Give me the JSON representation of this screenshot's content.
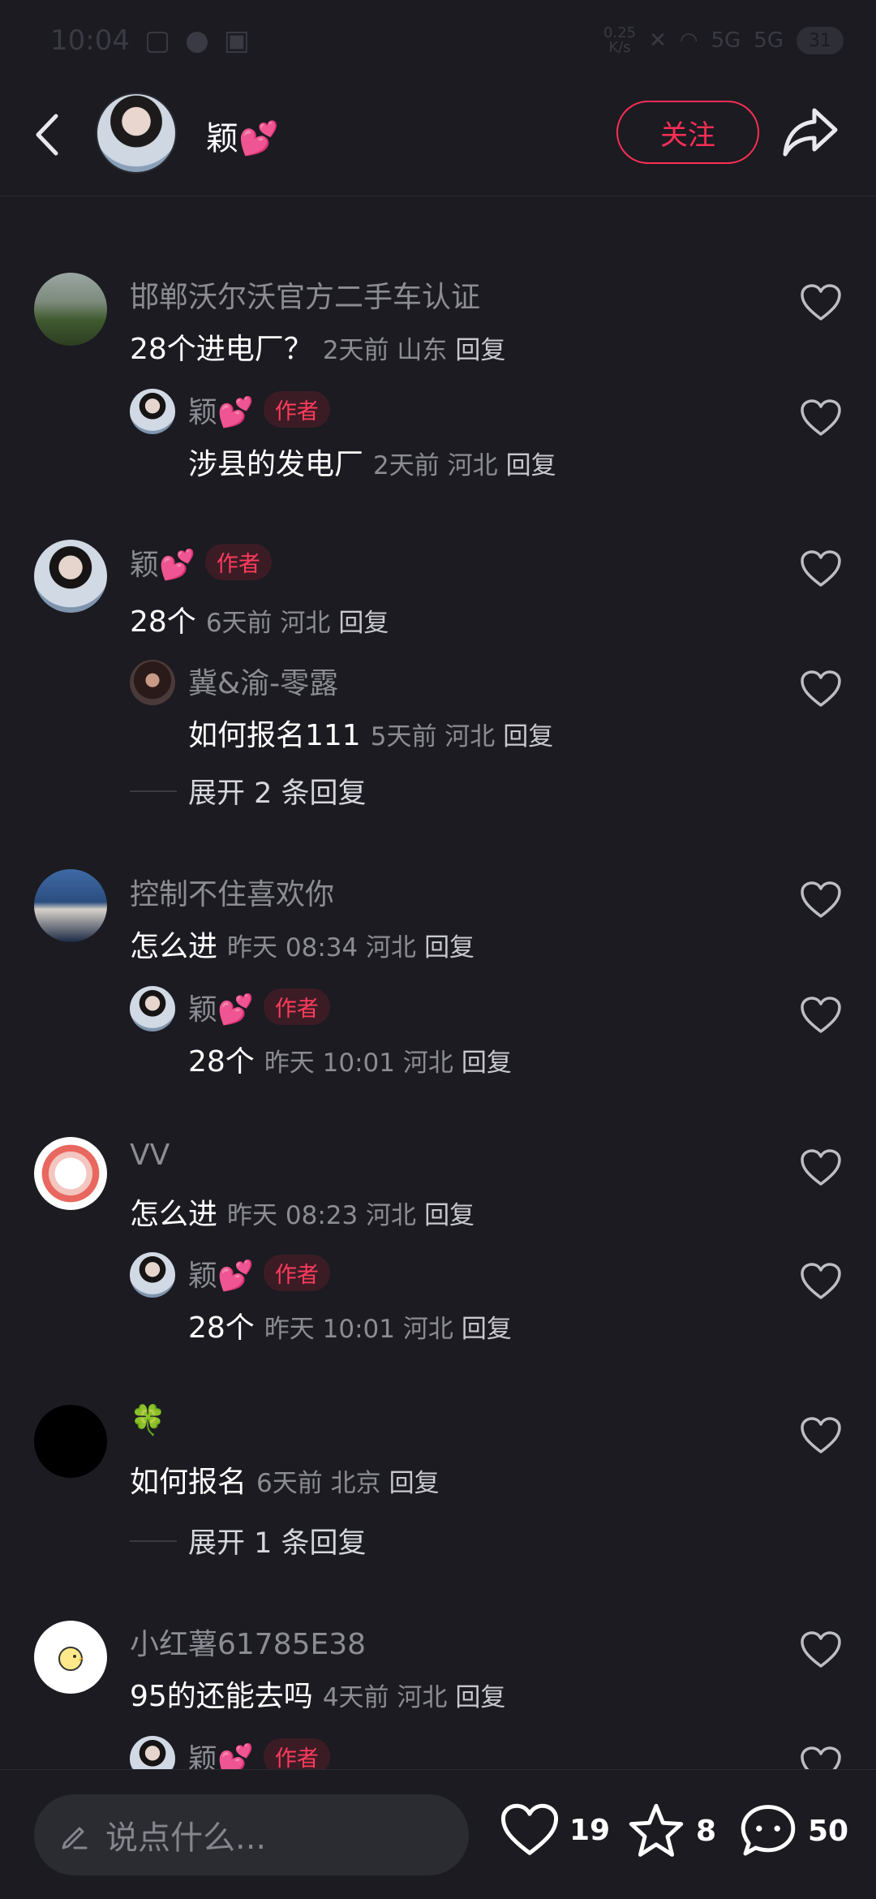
{
  "status_bar": {
    "time": "10:04",
    "net_speed_value": "0.25",
    "net_speed_unit": "K/s",
    "signal1": "5G",
    "signal2": "5G",
    "battery": "31"
  },
  "header": {
    "author_name": "颖💕",
    "follow_label": "关注"
  },
  "comments": [
    {
      "user": "邯郸沃尔沃官方二手车认证",
      "text": "28个进电厂？",
      "meta": "2天前 山东",
      "reply_label": "回复",
      "sub": {
        "user": "颖💕",
        "badge": "作者",
        "text": "涉县的发电厂",
        "meta": "2天前 河北",
        "reply_label": "回复"
      }
    },
    {
      "user": "颖💕",
      "badge": "作者",
      "text": "28个",
      "meta": "6天前 河北",
      "reply_label": "回复",
      "sub": {
        "user": "冀&渝-零露",
        "text": "如何报名111",
        "meta": "5天前 河北",
        "reply_label": "回复"
      },
      "expand": "展开 2 条回复"
    },
    {
      "user": "控制不住喜欢你",
      "text": "怎么进",
      "meta": "昨天 08:34 河北",
      "reply_label": "回复",
      "sub": {
        "user": "颖💕",
        "badge": "作者",
        "text": "28个",
        "meta": "昨天 10:01 河北",
        "reply_label": "回复"
      }
    },
    {
      "user": "VV",
      "text": "怎么进",
      "meta": "昨天 08:23 河北",
      "reply_label": "回复",
      "sub": {
        "user": "颖💕",
        "badge": "作者",
        "text": "28个",
        "meta": "昨天 10:01 河北",
        "reply_label": "回复"
      }
    },
    {
      "user": "🍀",
      "text": "如何报名",
      "meta": "6天前 北京",
      "reply_label": "回复",
      "expand": "展开 1 条回复"
    },
    {
      "user": "小红薯61785E38",
      "text": "95的还能去吗",
      "meta": "4天前 河北",
      "reply_label": "回复",
      "sub": {
        "user": "颖💕",
        "badge": "作者"
      }
    }
  ],
  "bottom_bar": {
    "input_placeholder": "说点什么...",
    "likes": "19",
    "stars": "8",
    "comments": "50"
  },
  "colors": {
    "background": "#1b1b21",
    "accent": "#ff2e55",
    "muted_text": "#8c8c94"
  }
}
